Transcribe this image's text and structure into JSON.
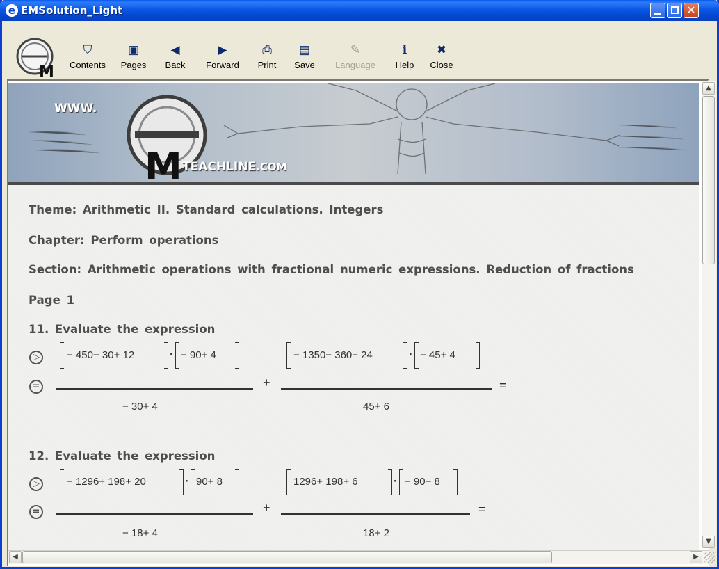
{
  "window": {
    "title": "EMSolution_Light",
    "controls": [
      "minimize",
      "maximize",
      "close"
    ]
  },
  "toolbar": {
    "logo_letter": "M",
    "items": [
      {
        "label": "Contents",
        "icon": "contents-icon",
        "enabled": true
      },
      {
        "label": "Pages",
        "icon": "pages-icon",
        "enabled": true
      },
      {
        "label": "Back",
        "icon": "back-arrow-icon",
        "enabled": true
      },
      {
        "label": "Forward",
        "icon": "forward-arrow-icon",
        "enabled": true
      },
      {
        "label": "Print",
        "icon": "printer-icon",
        "enabled": true
      },
      {
        "label": "Save",
        "icon": "floppy-disk-icon",
        "enabled": true
      },
      {
        "label": "Language",
        "icon": "language-icon",
        "enabled": false
      },
      {
        "label": "Help",
        "icon": "help-icon",
        "enabled": true
      },
      {
        "label": "Close",
        "icon": "close-icon",
        "enabled": true
      }
    ]
  },
  "banner": {
    "www": "WWW.",
    "brand_letter": "M",
    "brand_text": "TEACHLINE",
    "brand_tld": ".COM"
  },
  "content": {
    "theme": "Theme: Arithmetic II. Standard calculations. Integers",
    "chapter": "Chapter: Perform operations",
    "section": "Section: Arithmetic operations with fractional numeric expressions. Reduction of fractions",
    "page": "Page 1",
    "problems": [
      {
        "title": "11. Evaluate the expression",
        "left": {
          "numA": "− 450− 30+ 12",
          "numB": "− 90+ 4",
          "den": "− 30+ 4"
        },
        "right": {
          "numA": "− 1350− 360− 24",
          "numB": "− 45+ 4",
          "den": "45+ 6"
        },
        "plus": "+",
        "equals": "="
      },
      {
        "title": "12. Evaluate the expression",
        "left": {
          "numA": "− 1296+ 198+ 20",
          "numB": "90+ 8",
          "den": "− 18+ 4"
        },
        "right": {
          "numA": "1296+ 198+ 6",
          "numB": "− 90− 8",
          "den": "18+ 2"
        },
        "plus": "+",
        "equals": "="
      }
    ]
  },
  "colors": {
    "titlebar": "#0a58e6",
    "text": "#4e4e4e",
    "background": "#ece9d8"
  }
}
